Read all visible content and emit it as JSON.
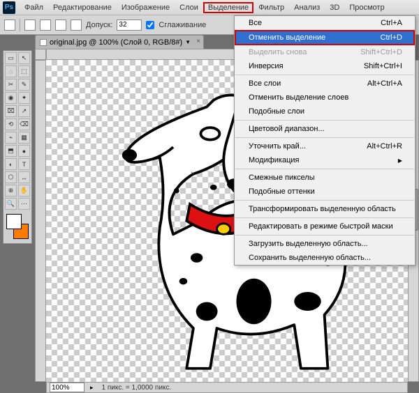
{
  "app_logo": "Ps",
  "menubar": {
    "items": [
      "Файл",
      "Редактирование",
      "Изображение",
      "Слои",
      "Выделение",
      "Фильтр",
      "Анализ",
      "3D",
      "Просмотр"
    ],
    "highlighted_index": 4
  },
  "options_bar": {
    "tolerance_label": "Допуск:",
    "tolerance_value": "32",
    "antialias_label": "Сглаживание"
  },
  "tab": {
    "filename": "original.jpg",
    "zoom": "100%",
    "layer_info": "(Слой 0, RGB/8#)",
    "full": "original.jpg @ 100% (Слой 0, RGB/8#)"
  },
  "status": {
    "zoom": "100%",
    "text": "1 пикс. = 1,0000 пикс."
  },
  "dropdown": {
    "groups": [
      [
        {
          "label": "Все",
          "shortcut": "Ctrl+A",
          "disabled": false,
          "highlight": false
        },
        {
          "label": "Отменить выделение",
          "shortcut": "Ctrl+D",
          "disabled": false,
          "highlight": true
        },
        {
          "label": "Выделить снова",
          "shortcut": "Shift+Ctrl+D",
          "disabled": true,
          "highlight": false
        },
        {
          "label": "Инверсия",
          "shortcut": "Shift+Ctrl+I",
          "disabled": false,
          "highlight": false
        }
      ],
      [
        {
          "label": "Все слои",
          "shortcut": "Alt+Ctrl+A",
          "disabled": false,
          "highlight": false
        },
        {
          "label": "Отменить выделение слоев",
          "shortcut": "",
          "disabled": false,
          "highlight": false
        },
        {
          "label": "Подобные слои",
          "shortcut": "",
          "disabled": false,
          "highlight": false
        }
      ],
      [
        {
          "label": "Цветовой диапазон...",
          "shortcut": "",
          "disabled": false,
          "highlight": false
        }
      ],
      [
        {
          "label": "Уточнить край...",
          "shortcut": "Alt+Ctrl+R",
          "disabled": false,
          "highlight": false
        },
        {
          "label": "Модификация",
          "shortcut": "",
          "disabled": false,
          "highlight": false,
          "submenu": true
        }
      ],
      [
        {
          "label": "Смежные пикселы",
          "shortcut": "",
          "disabled": false,
          "highlight": false
        },
        {
          "label": "Подобные оттенки",
          "shortcut": "",
          "disabled": false,
          "highlight": false
        }
      ],
      [
        {
          "label": "Трансформировать выделенную область",
          "shortcut": "",
          "disabled": false,
          "highlight": false
        }
      ],
      [
        {
          "label": "Редактировать в режиме быстрой маски",
          "shortcut": "",
          "disabled": false,
          "highlight": false
        }
      ],
      [
        {
          "label": "Загрузить выделенную область...",
          "shortcut": "",
          "disabled": false,
          "highlight": false
        },
        {
          "label": "Сохранить выделенную область...",
          "shortcut": "",
          "disabled": false,
          "highlight": false
        }
      ]
    ]
  },
  "tool_glyphs": [
    "▭",
    "↖",
    "◌",
    "⬚",
    "✂",
    "✎",
    "◉",
    "✦",
    "⌧",
    "↗",
    "⟲",
    "⌫",
    "⌁",
    "▦",
    "⬒",
    "●",
    "◐",
    "T",
    "⬡",
    "↔",
    "⊕",
    "✋",
    "🔍",
    "⋯"
  ],
  "colors": {
    "fg": "#ffffff",
    "bg": "#ff7a00"
  }
}
